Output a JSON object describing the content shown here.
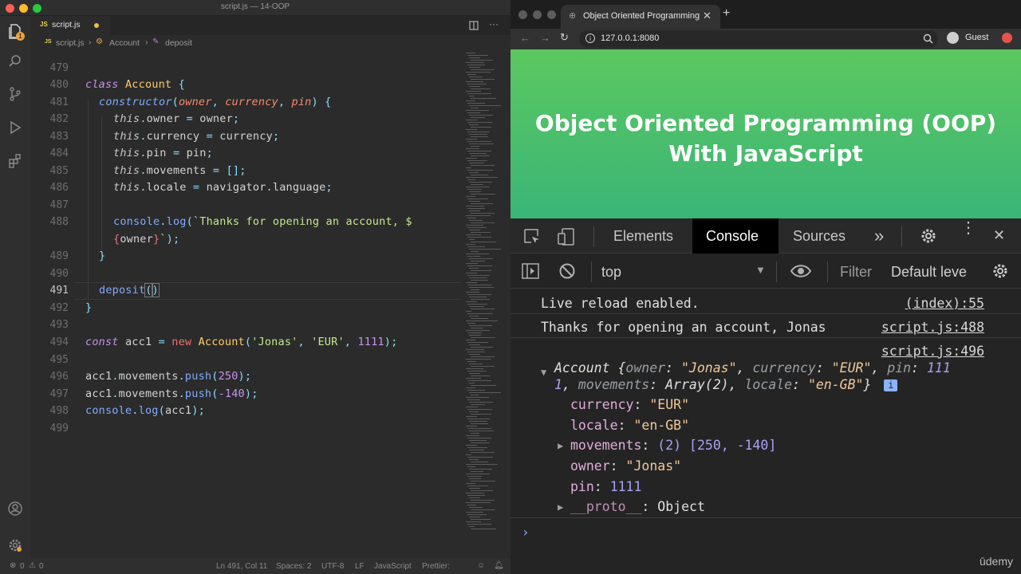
{
  "vscode": {
    "window_title": "script.js — 14-OOP",
    "tab_label": "script.js",
    "tab_file_icon": "JS",
    "breadcrumb": {
      "file": "script.js",
      "class": "Account",
      "method": "deposit"
    },
    "activity_badge": "1",
    "status": {
      "errors": "0",
      "warnings": "0",
      "position": "Ln 491, Col 11",
      "spaces": "Spaces: 2",
      "encoding": "UTF-8",
      "eol": "LF",
      "language": "JavaScript",
      "formatter": "Prettier:"
    },
    "line_numbers": [
      "479",
      "480",
      "481",
      "482",
      "483",
      "484",
      "485",
      "486",
      "487",
      "488",
      "",
      "489",
      "490",
      "491",
      "492",
      "493",
      "494",
      "495",
      "496",
      "497",
      "498",
      "499"
    ],
    "code": {
      "l480_kw": "class",
      "l480_name": "Account",
      "l480_brace": "{",
      "l481_fn": "constructor",
      "l481_p1": "owner",
      "l481_p2": "currency",
      "l481_p3": "pin",
      "l482_this": "this",
      "l482_prop": "owner",
      "l482_val": "owner",
      "l483_this": "this",
      "l483_prop": "currency",
      "l483_val": "currency",
      "l484_this": "this",
      "l484_prop": "pin",
      "l484_val": "pin",
      "l485_this": "this",
      "l485_prop": "movements",
      "l485_val": "[]",
      "l486_this": "this",
      "l486_prop": "locale",
      "l486_obj": "navigator",
      "l486_val": "language",
      "l488_obj": "console",
      "l488_fn": "log",
      "l488_str": "`Thanks for opening an account, $",
      "l488b_var": "owner",
      "l491_fn": "deposit",
      "l494_kw": "const",
      "l494_var": "acc1",
      "l494_new": "new",
      "l494_cls": "Account",
      "l494_s1": "'Jonas'",
      "l494_s2": "'EUR'",
      "l494_n": "1111",
      "l496_var": "acc1",
      "l496_prop": "movements",
      "l496_fn": "push",
      "l496_n": "250",
      "l497_var": "acc1",
      "l497_prop": "movements",
      "l497_fn": "push",
      "l497_n": "-140",
      "l498_obj": "console",
      "l498_fn": "log",
      "l498_arg": "acc1"
    }
  },
  "browser": {
    "tab_title": "Object Oriented Programming",
    "url": "127.0.0.1:8080",
    "profile": "Guest",
    "page_heading_line1": "Object Oriented Programming (OOP)",
    "page_heading_line2": "With JavaScript"
  },
  "devtools": {
    "tabs": [
      "Elements",
      "Console",
      "Sources"
    ],
    "active_tab": "Console",
    "context": "top",
    "filter_placeholder": "Filter",
    "levels": "Default leve",
    "console": [
      {
        "text": "Live reload enabled.",
        "source": "(index):55"
      },
      {
        "text": "Thanks for opening an account, Jonas",
        "source": "script.js:488"
      },
      {
        "text": "",
        "source": "script.js:496"
      }
    ],
    "object_summary": {
      "class": "Account",
      "owner": "\"Jonas\"",
      "currency": "\"EUR\"",
      "pin_part1": "111",
      "pin_part2": "1",
      "movements": "Array(2)",
      "locale": "\"en-GB\""
    },
    "object_props": [
      {
        "key": "currency",
        "value": "\"EUR\""
      },
      {
        "key": "locale",
        "value": "\"en-GB\""
      },
      {
        "key": "movements",
        "value": "(2) [250, -140]"
      },
      {
        "key": "owner",
        "value": "\"Jonas\""
      },
      {
        "key": "pin",
        "value": "1111"
      },
      {
        "key": "__proto__",
        "value": "Object"
      }
    ]
  },
  "watermark": "ūdemy",
  "colors": {
    "page_gradient_top": "#5bc85f",
    "page_gradient_bottom": "#3ab577",
    "vscode_bg": "#2b2b2b",
    "devtools_bg": "#242424"
  }
}
